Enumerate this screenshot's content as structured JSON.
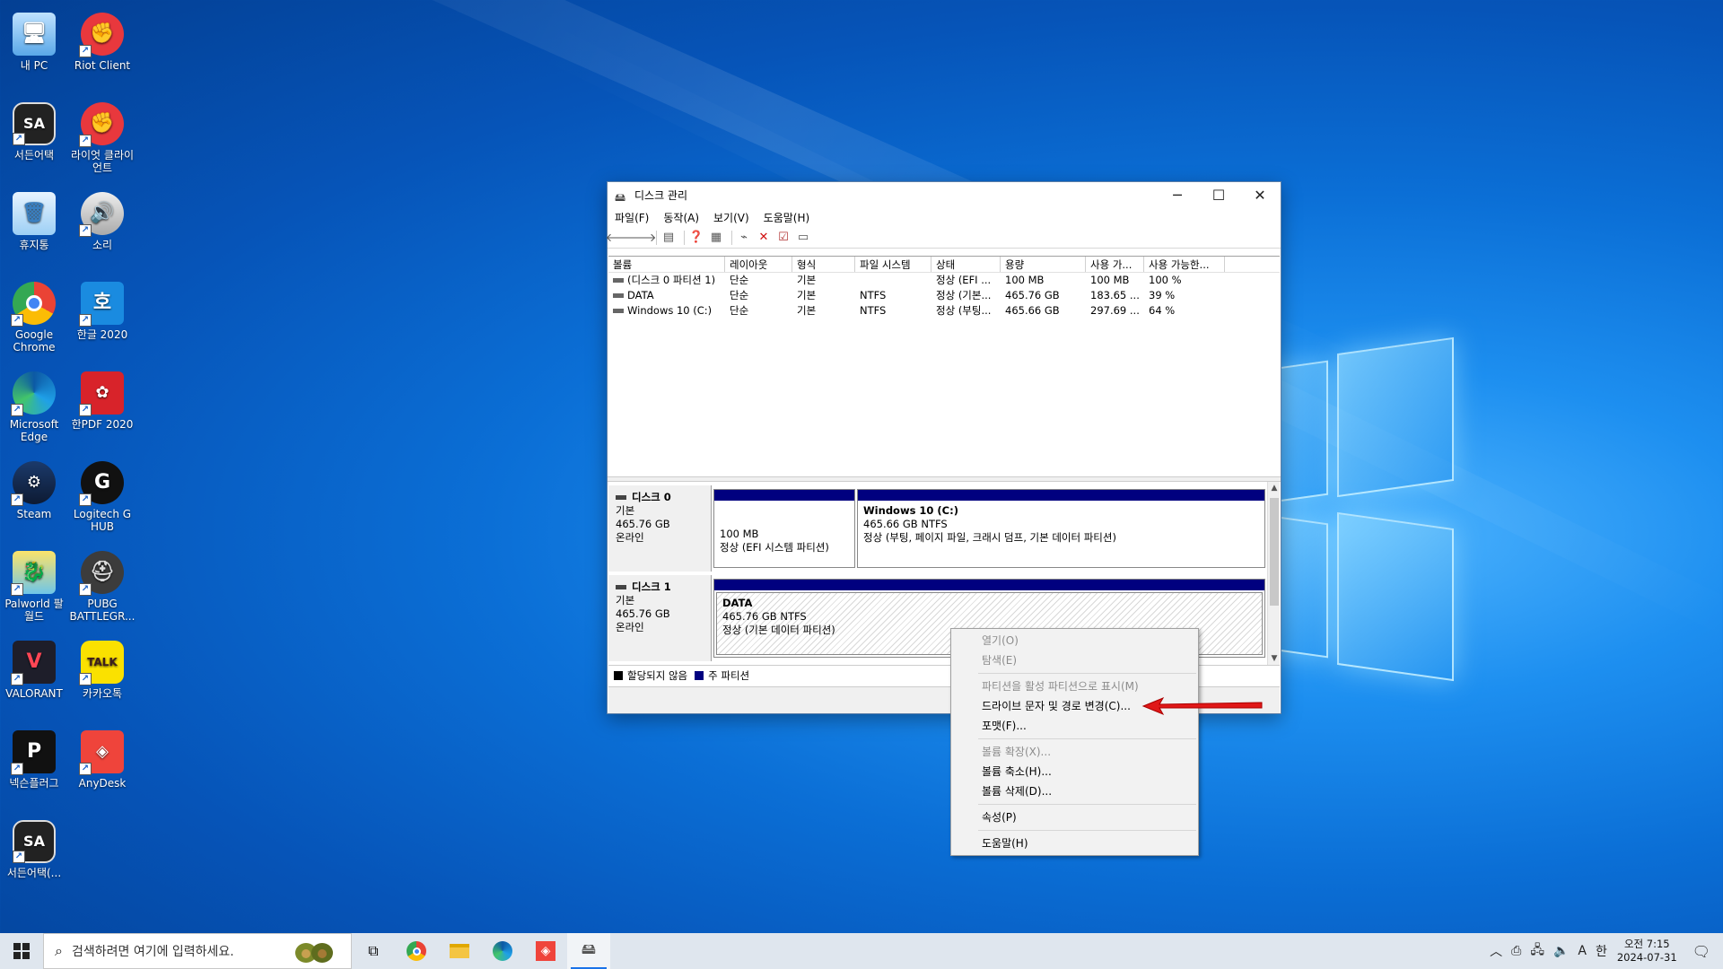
{
  "desktop": {
    "icons": [
      {
        "label": "내 PC",
        "icon": "this-pc-icon"
      },
      {
        "label": "Riot Client",
        "icon": "riot-client-icon"
      },
      {
        "label": "서든어택",
        "icon": "sudden-attack-icon"
      },
      {
        "label": "라이엇 클라이언트",
        "icon": "riot-client-icon"
      },
      {
        "label": "휴지통",
        "icon": "recycle-bin-icon"
      },
      {
        "label": "소리",
        "icon": "sound-icon"
      },
      {
        "label": "Google Chrome",
        "icon": "chrome-icon"
      },
      {
        "label": "한글 2020",
        "icon": "hangul-icon"
      },
      {
        "label": "Microsoft Edge",
        "icon": "edge-icon"
      },
      {
        "label": "한PDF 2020",
        "icon": "hanpdf-icon"
      },
      {
        "label": "Steam",
        "icon": "steam-icon"
      },
      {
        "label": "Logitech G HUB",
        "icon": "logitech-icon"
      },
      {
        "label": "Palworld 팔월드",
        "icon": "palworld-icon"
      },
      {
        "label": "PUBG BATTLEGR...",
        "icon": "pubg-icon"
      },
      {
        "label": "VALORANT",
        "icon": "valorant-icon"
      },
      {
        "label": "카카오톡",
        "icon": "kakaotalk-icon"
      },
      {
        "label": "넥슨플러그",
        "icon": "nexon-plug-icon"
      },
      {
        "label": "AnyDesk",
        "icon": "anydesk-icon"
      },
      {
        "label": "서든어택(...",
        "icon": "sudden-attack-icon"
      }
    ]
  },
  "window": {
    "title": "디스크 관리",
    "menu": [
      "파일(F)",
      "동작(A)",
      "보기(V)",
      "도움말(H)"
    ],
    "columns": [
      "볼륨",
      "레이아웃",
      "형식",
      "파일 시스템",
      "상태",
      "용량",
      "사용 가...",
      "사용 가능한..."
    ],
    "volumes": [
      [
        "(디스크 0 파티션 1)",
        "단순",
        "기본",
        "",
        "정상 (EFI ...",
        "100 MB",
        "100 MB",
        "100 %"
      ],
      [
        "DATA",
        "단순",
        "기본",
        "NTFS",
        "정상 (기본...",
        "465.76 GB",
        "183.65 ...",
        "39 %"
      ],
      [
        "Windows 10 (C:)",
        "단순",
        "기본",
        "NTFS",
        "정상 (부팅...",
        "465.66 GB",
        "297.69 ...",
        "64 %"
      ]
    ],
    "disks": [
      {
        "name": "디스크 0",
        "type": "기본",
        "size": "465.76 GB",
        "status": "온라인",
        "partitions": [
          {
            "title": "",
            "size": "100 MB",
            "status": "정상 (EFI 시스템 파티션)"
          },
          {
            "title": "Windows 10  (C:)",
            "size": "465.66 GB NTFS",
            "status": "정상 (부팅, 페이지 파일, 크래시 덤프, 기본 데이터 파티션)"
          }
        ]
      },
      {
        "name": "디스크 1",
        "type": "기본",
        "size": "465.76 GB",
        "status": "온라인",
        "partitions": [
          {
            "title": "DATA",
            "size": "465.76 GB NTFS",
            "status": "정상 (기본 데이터 파티션)"
          }
        ]
      }
    ],
    "legend": [
      "할당되지 않음",
      "주 파티션"
    ],
    "colors": {
      "unallocated": "#000000",
      "primary": "#00007f"
    }
  },
  "context_menu": {
    "items": [
      {
        "label": "열기(O)",
        "enabled": false
      },
      {
        "label": "탐색(E)",
        "enabled": false
      },
      {
        "label": "파티션을 활성 파티션으로 표시(M)",
        "enabled": false
      },
      {
        "label": "드라이브 문자 및 경로 변경(C)...",
        "enabled": true
      },
      {
        "label": "포맷(F)...",
        "enabled": true
      },
      {
        "label": "볼륨 확장(X)...",
        "enabled": false
      },
      {
        "label": "볼륨 축소(H)...",
        "enabled": true
      },
      {
        "label": "볼륨 삭제(D)...",
        "enabled": true
      },
      {
        "label": "속성(P)",
        "enabled": true
      },
      {
        "label": "도움말(H)",
        "enabled": true
      }
    ]
  },
  "taskbar": {
    "search_placeholder": "검색하려면 여기에 입력하세요.",
    "tray": {
      "ime": "A",
      "lang": "한"
    },
    "clock": {
      "time": "오전 7:15",
      "date": "2024-07-31"
    }
  }
}
